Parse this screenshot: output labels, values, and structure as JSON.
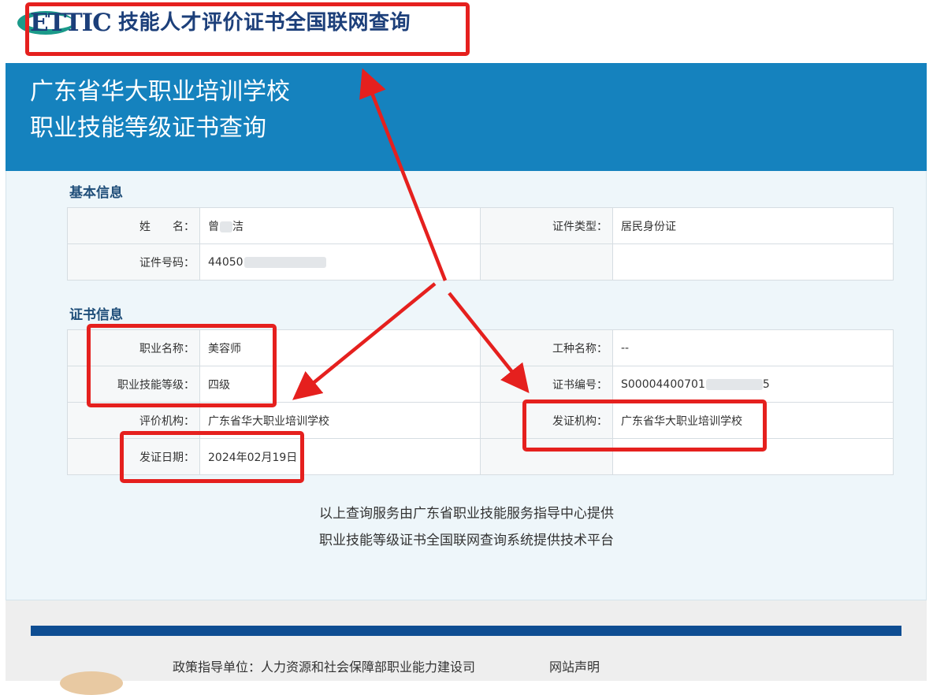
{
  "logo": {
    "brand": "ETTIC",
    "title": "技能人才评价证书全国联网查询"
  },
  "header": {
    "line1": "广东省华大职业培训学校",
    "line2": "职业技能等级证书查询"
  },
  "basic_info": {
    "title": "基本信息",
    "name_label": "姓　　名：",
    "name_prefix": "曾",
    "name_suffix": "洁",
    "id_type_label": "证件类型：",
    "id_type_value": "居民身份证",
    "id_number_label": "证件号码：",
    "id_number_prefix": "44050"
  },
  "cert_info": {
    "title": "证书信息",
    "occupation_label": "职业名称：",
    "occupation_value": "美容师",
    "job_type_label": "工种名称：",
    "job_type_value": "--",
    "level_label": "职业技能等级：",
    "level_value": "四级",
    "cert_no_label": "证书编号：",
    "cert_no_prefix": "S00004400701",
    "cert_no_suffix": "5",
    "eval_org_label": "评价机构：",
    "eval_org_value": "广东省华大职业培训学校",
    "issue_org_label": "发证机构：",
    "issue_org_value": "广东省华大职业培训学校",
    "issue_date_label": "发证日期：",
    "issue_date_value": "2024年02月19日"
  },
  "notes": {
    "line1": "以上查询服务由广东省职业技能服务指导中心提供",
    "line2": "职业技能等级证书全国联网查询系统提供技术平台"
  },
  "footer": {
    "policy_unit": "政策指导单位：人力资源和社会保障部职业能力建设司",
    "site_statement": "网站声明"
  },
  "colors": {
    "header_blue": "#1582be",
    "annotation_red": "#e5201e",
    "footer_bar": "#0e4d92"
  }
}
